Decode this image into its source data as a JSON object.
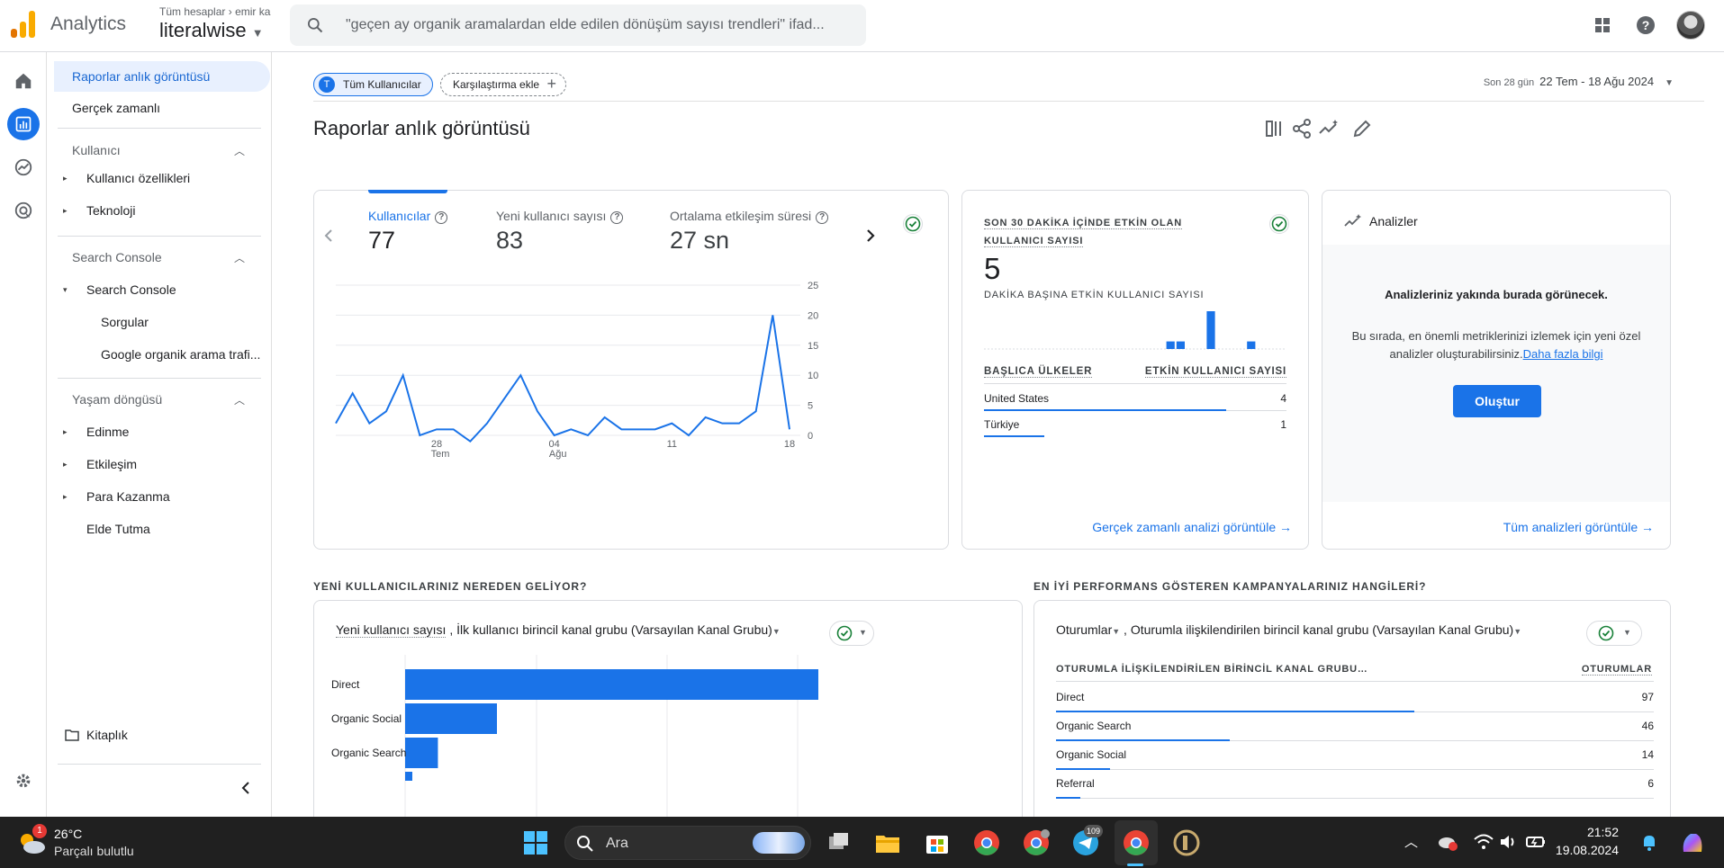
{
  "topbar": {
    "app_title": "Analytics",
    "account_path_1": "Tüm hesaplar",
    "account_path_2": "emir ka",
    "property_name": "literalwise",
    "search_placeholder": "\"geçen ay organik aramalardan elde edilen dönüşüm sayısı trendleri\" ifad..."
  },
  "sidebar": {
    "items": [
      {
        "label": "Raporlar anlık görüntüsü"
      },
      {
        "label": "Gerçek zamanlı"
      },
      {
        "label": "Kullanıcı"
      },
      {
        "label": "Kullanıcı özellikleri"
      },
      {
        "label": "Teknoloji"
      },
      {
        "label": "Search Console"
      },
      {
        "label": "Search Console"
      },
      {
        "label": "Sorgular"
      },
      {
        "label": "Google organik arama trafi..."
      },
      {
        "label": "Yaşam döngüsü"
      },
      {
        "label": "Edinme"
      },
      {
        "label": "Etkileşim"
      },
      {
        "label": "Para Kazanma"
      },
      {
        "label": "Elde Tutma"
      },
      {
        "label": "Kitaplık"
      }
    ]
  },
  "header": {
    "segment_chip": "Tüm Kullanıcılar",
    "segment_initial": "T",
    "compare_chip": "Karşılaştırma ekle",
    "date_label": "Son 28 gün",
    "date_range": "22 Tem - 18 Ağu 2024",
    "page_title": "Raporlar anlık görüntüsü"
  },
  "overview": {
    "metrics": [
      {
        "label": "Kullanıcılar",
        "value": "77"
      },
      {
        "label": "Yeni kullanıcı sayısı",
        "value": "83"
      },
      {
        "label": "Ortalama etkileşim süresi",
        "value": "27 sn"
      }
    ]
  },
  "chart_data": [
    {
      "type": "line",
      "x_ticks": [
        "28",
        "04",
        "11",
        "18"
      ],
      "x_subticks": [
        "Tem",
        "Ağu",
        "",
        ""
      ],
      "y_ticks": [
        0,
        5,
        10,
        15,
        20,
        25
      ],
      "ylim": [
        0,
        25
      ],
      "series": [
        {
          "values": [
            2,
            7,
            2,
            4,
            10,
            0,
            1,
            1,
            -1,
            2,
            6,
            10,
            4,
            0,
            1,
            0,
            3,
            1,
            1,
            1,
            2,
            0,
            3,
            2,
            2,
            4,
            20,
            1
          ]
        }
      ]
    },
    {
      "type": "bar",
      "values": [
        0,
        0,
        0,
        0,
        0,
        0,
        0,
        0,
        0,
        0,
        0,
        0,
        0,
        0,
        0,
        0,
        0,
        0,
        1,
        1,
        0,
        0,
        5,
        0,
        0,
        0,
        1,
        0,
        0,
        0
      ]
    },
    {
      "type": "bar",
      "orientation": "horizontal",
      "categories": [
        "Direct",
        "Organic Social",
        "Organic Search"
      ],
      "values": [
        63,
        14,
        5
      ]
    }
  ],
  "realtime": {
    "title": "SON 30 DAKİKA İÇİNDE ETKİN OLAN KULLANICI SAYISI",
    "value": "5",
    "subtitle": "DAKİKA BAŞINA ETKİN KULLANICI SAYISI",
    "col_country": "BAŞLICA ÜLKELER",
    "col_users": "ETKİN KULLANICI SAYISI",
    "rows": [
      {
        "country": "United States",
        "users": "4",
        "share": 0.8
      },
      {
        "country": "Türkiye",
        "users": "1",
        "share": 0.2
      }
    ],
    "link": "Gerçek zamanlı analizi görüntüle"
  },
  "insights": {
    "title": "Analizler",
    "heading": "Analizleriniz yakında burada görünecek.",
    "body": "Bu sırada, en önemli metriklerinizi izlemek için yeni özel analizler oluşturabilirsiniz.",
    "more_link": "Daha fazla bilgi",
    "create_button": "Oluştur",
    "view_all": "Tüm analizleri görüntüle"
  },
  "new_users": {
    "section_title": "YENİ KULLANICILARINIZ NEREDEN GELİYOR?",
    "selector_metric": "Yeni kullanıcı sayısı",
    "selector_dim": " , İlk kullanıcı birincil kanal grubu (Varsayılan Kanal Grubu)"
  },
  "campaigns": {
    "section_title": "EN İYİ PERFORMANS GÖSTEREN KAMPANYALARINIZ HANGİLERİ?",
    "selector_metric": "Oturumlar",
    "selector_dim": " , Oturumla ilişkilendirilen birincil kanal grubu (Varsayılan Kanal Grubu)",
    "col_channel": "OTURUMLA İLİŞKİLENDİRİLEN BİRİNCİL KANAL GRUBU…",
    "col_sessions": "OTURUMLAR",
    "rows": [
      {
        "channel": "Direct",
        "sessions": "97",
        "share": 0.6
      },
      {
        "channel": "Organic Search",
        "sessions": "46",
        "share": 0.29
      },
      {
        "channel": "Organic Social",
        "sessions": "14",
        "share": 0.09
      },
      {
        "channel": "Referral",
        "sessions": "6",
        "share": 0.04
      }
    ]
  },
  "taskbar": {
    "temp": "26°C",
    "weather": "Parçalı bulutlu",
    "weather_badge": "1",
    "search_label": "Ara",
    "telegram_badge": "109",
    "time": "21:52",
    "date": "19.08.2024"
  },
  "colors": {
    "accent": "#1a73e8",
    "logo_orange": "#f9ab00",
    "logo_dark_orange": "#e37400"
  }
}
